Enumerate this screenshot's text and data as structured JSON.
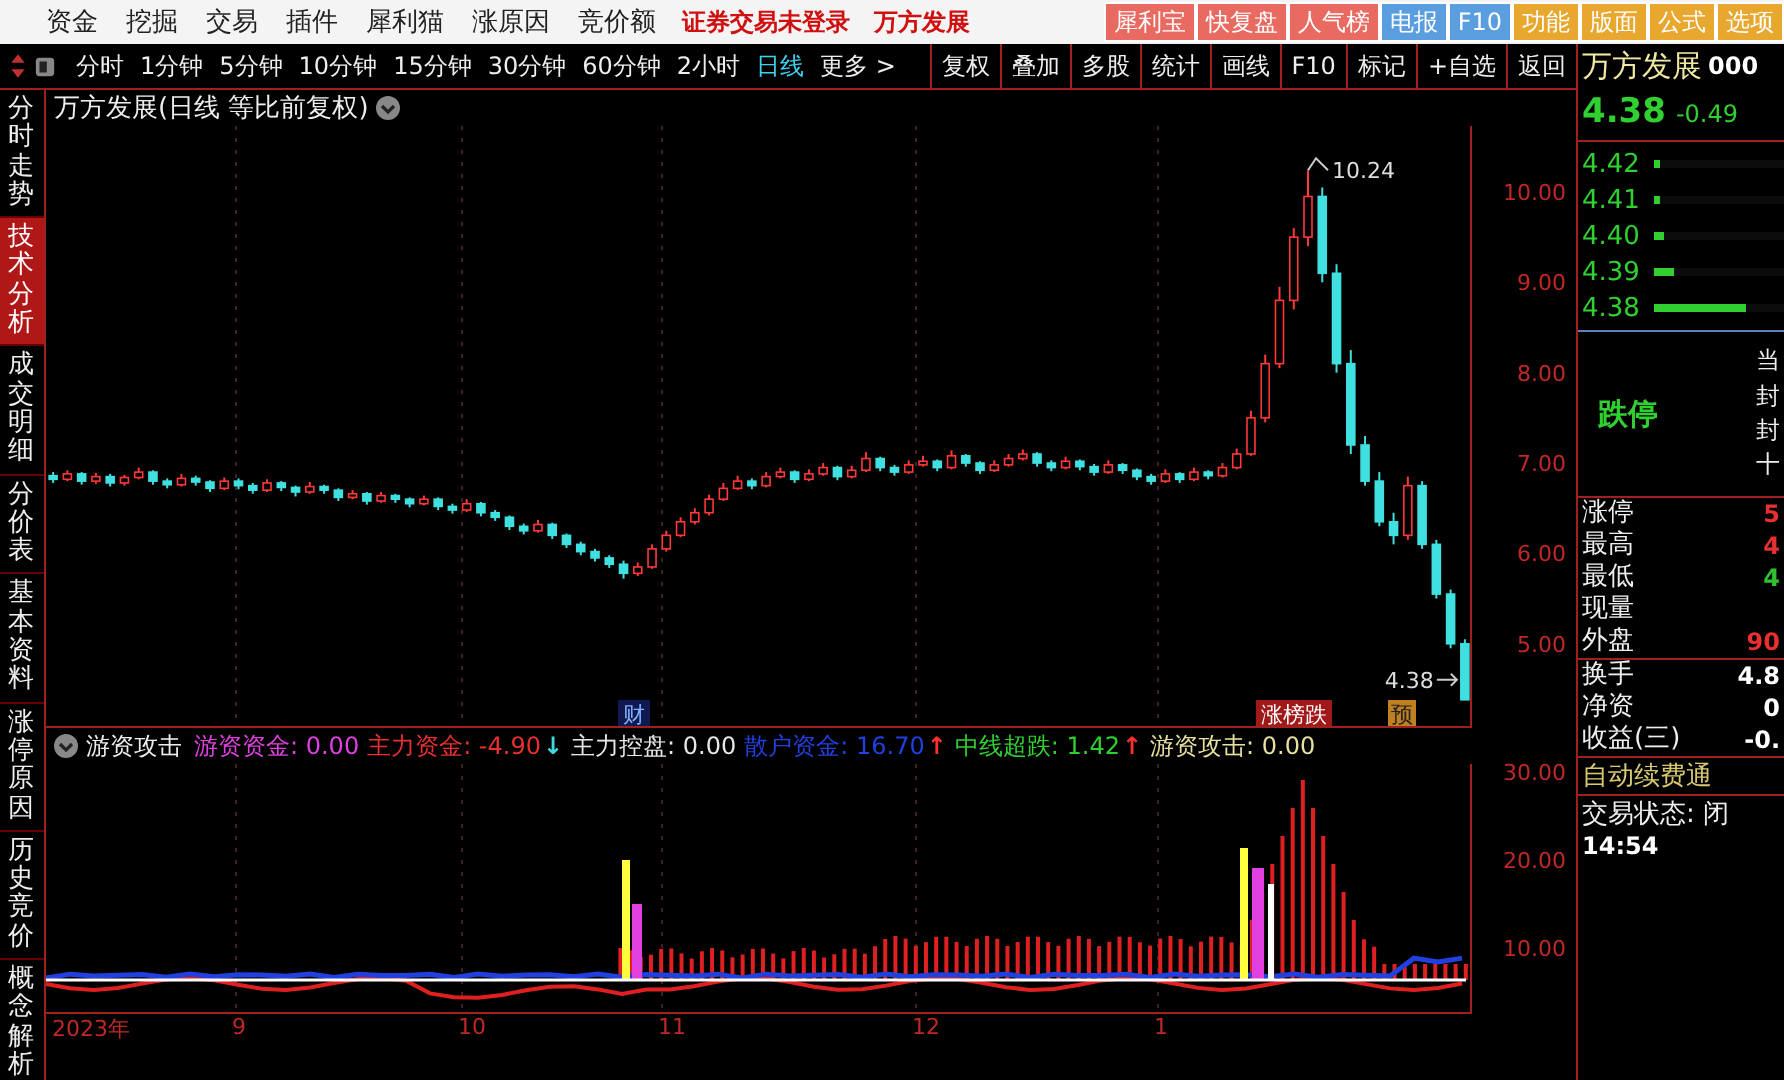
{
  "menu_bar": {
    "items": [
      "资金",
      "挖掘",
      "交易",
      "插件",
      "犀利猫",
      "涨原因",
      "竞价额"
    ],
    "status_texts": [
      "证券交易未登录",
      "万方发展"
    ],
    "buttons": [
      {
        "label": "犀利宝",
        "color": "#e86a60"
      },
      {
        "label": "快复盘",
        "color": "#e86a60"
      },
      {
        "label": "人气榜",
        "color": "#e86a60"
      },
      {
        "label": "电报",
        "color": "#5a9ee0"
      },
      {
        "label": "F10",
        "color": "#5a9ee0"
      },
      {
        "label": "功能",
        "color": "#e8a830"
      },
      {
        "label": "版面",
        "color": "#e8a830"
      },
      {
        "label": "公式",
        "color": "#e8a830"
      },
      {
        "label": "选项",
        "color": "#e8a830"
      }
    ]
  },
  "toolbar": {
    "periods": [
      {
        "label": "分时",
        "selected": false
      },
      {
        "label": "1分钟",
        "selected": false
      },
      {
        "label": "5分钟",
        "selected": false
      },
      {
        "label": "10分钟",
        "selected": false
      },
      {
        "label": "15分钟",
        "selected": false
      },
      {
        "label": "30分钟",
        "selected": false
      },
      {
        "label": "60分钟",
        "selected": false
      },
      {
        "label": "2小时",
        "selected": false
      },
      {
        "label": "日线",
        "selected": true
      },
      {
        "label": "更多 >",
        "selected": false
      }
    ],
    "tools": [
      "复权",
      "叠加",
      "多股",
      "统计",
      "画线",
      "F10",
      "标记",
      "+自选",
      "返回"
    ]
  },
  "side_tabs": [
    {
      "label": "分时走势",
      "selected": false
    },
    {
      "label": "技术分析",
      "selected": true
    },
    {
      "label": "成交明细",
      "selected": false
    },
    {
      "label": "分价表",
      "selected": false
    },
    {
      "label": "基本资料",
      "selected": false
    },
    {
      "label": "涨停原因",
      "selected": false
    },
    {
      "label": "历史竞价",
      "selected": false
    },
    {
      "label": "概念解析",
      "selected": false
    }
  ],
  "chart": {
    "title": "万方发展(日线 等比前复权)",
    "high_label": "10.24",
    "last_label": "4.38",
    "markers": [
      {
        "label": "财",
        "kind": "event"
      },
      {
        "label": "涨榜跌",
        "kind": "hot"
      },
      {
        "label": "预",
        "kind": "forecast"
      }
    ],
    "chart_data": {
      "type": "candlestick",
      "ylim": [
        4.09,
        10.73
      ],
      "yticks": [
        {
          "value": 10,
          "label": "10.00"
        },
        {
          "value": 9,
          "label": "9.00"
        },
        {
          "value": 8,
          "label": "8.00"
        },
        {
          "value": 7,
          "label": "7.00"
        },
        {
          "value": 6,
          "label": "6.00"
        },
        {
          "value": 5,
          "label": "5.00"
        }
      ],
      "ohlc": [
        [
          6.86,
          6.9,
          6.78,
          6.82
        ],
        [
          6.82,
          6.92,
          6.8,
          6.88
        ],
        [
          6.88,
          6.9,
          6.76,
          6.8
        ],
        [
          6.8,
          6.89,
          6.77,
          6.85
        ],
        [
          6.85,
          6.88,
          6.74,
          6.78
        ],
        [
          6.78,
          6.87,
          6.75,
          6.84
        ],
        [
          6.84,
          6.95,
          6.82,
          6.9
        ],
        [
          6.9,
          6.92,
          6.76,
          6.8
        ],
        [
          6.8,
          6.83,
          6.72,
          6.76
        ],
        [
          6.76,
          6.88,
          6.74,
          6.83
        ],
        [
          6.83,
          6.86,
          6.75,
          6.79
        ],
        [
          6.79,
          6.81,
          6.68,
          6.72
        ],
        [
          6.72,
          6.84,
          6.7,
          6.8
        ],
        [
          6.8,
          6.83,
          6.71,
          6.75
        ],
        [
          6.75,
          6.78,
          6.66,
          6.7
        ],
        [
          6.7,
          6.82,
          6.68,
          6.78
        ],
        [
          6.78,
          6.8,
          6.69,
          6.73
        ],
        [
          6.73,
          6.75,
          6.63,
          6.68
        ],
        [
          6.68,
          6.79,
          6.66,
          6.74
        ],
        [
          6.74,
          6.76,
          6.66,
          6.7
        ],
        [
          6.7,
          6.72,
          6.58,
          6.62
        ],
        [
          6.62,
          6.7,
          6.6,
          6.66
        ],
        [
          6.66,
          6.68,
          6.54,
          6.58
        ],
        [
          6.58,
          6.68,
          6.56,
          6.64
        ],
        [
          6.64,
          6.66,
          6.56,
          6.6
        ],
        [
          6.6,
          6.62,
          6.51,
          6.55
        ],
        [
          6.55,
          6.64,
          6.53,
          6.6
        ],
        [
          6.6,
          6.62,
          6.48,
          6.52
        ],
        [
          6.52,
          6.55,
          6.44,
          6.48
        ],
        [
          6.48,
          6.6,
          6.46,
          6.55
        ],
        [
          6.55,
          6.57,
          6.41,
          6.45
        ],
        [
          6.45,
          6.48,
          6.36,
          6.4
        ],
        [
          6.4,
          6.42,
          6.26,
          6.3
        ],
        [
          6.3,
          6.33,
          6.21,
          6.25
        ],
        [
          6.25,
          6.37,
          6.23,
          6.32
        ],
        [
          6.32,
          6.34,
          6.16,
          6.2
        ],
        [
          6.2,
          6.22,
          6.06,
          6.1
        ],
        [
          6.1,
          6.13,
          5.98,
          6.02
        ],
        [
          6.02,
          6.05,
          5.91,
          5.95
        ],
        [
          5.95,
          5.98,
          5.84,
          5.88
        ],
        [
          5.88,
          5.92,
          5.72,
          5.78
        ],
        [
          5.78,
          5.9,
          5.75,
          5.85
        ],
        [
          5.85,
          6.1,
          5.83,
          6.05
        ],
        [
          6.05,
          6.25,
          6.02,
          6.2
        ],
        [
          6.2,
          6.4,
          6.18,
          6.35
        ],
        [
          6.35,
          6.5,
          6.32,
          6.45
        ],
        [
          6.45,
          6.65,
          6.42,
          6.6
        ],
        [
          6.6,
          6.78,
          6.58,
          6.72
        ],
        [
          6.72,
          6.86,
          6.7,
          6.8
        ],
        [
          6.8,
          6.83,
          6.71,
          6.75
        ],
        [
          6.75,
          6.9,
          6.73,
          6.85
        ],
        [
          6.85,
          6.95,
          6.83,
          6.9
        ],
        [
          6.9,
          6.92,
          6.78,
          6.82
        ],
        [
          6.82,
          6.93,
          6.8,
          6.88
        ],
        [
          6.88,
          7.0,
          6.86,
          6.95
        ],
        [
          6.95,
          6.97,
          6.81,
          6.85
        ],
        [
          6.85,
          6.97,
          6.83,
          6.92
        ],
        [
          6.92,
          7.12,
          6.9,
          7.05
        ],
        [
          7.05,
          7.07,
          6.91,
          6.95
        ],
        [
          6.95,
          6.98,
          6.86,
          6.9
        ],
        [
          6.9,
          7.03,
          6.88,
          6.98
        ],
        [
          6.98,
          7.08,
          6.96,
          7.02
        ],
        [
          7.02,
          7.04,
          6.91,
          6.95
        ],
        [
          6.95,
          7.14,
          6.93,
          7.08
        ],
        [
          7.08,
          7.1,
          6.96,
          7.0
        ],
        [
          7.0,
          7.02,
          6.88,
          6.92
        ],
        [
          6.92,
          7.03,
          6.9,
          6.98
        ],
        [
          6.98,
          7.1,
          6.96,
          7.05
        ],
        [
          7.05,
          7.15,
          7.03,
          7.1
        ],
        [
          7.1,
          7.12,
          6.96,
          7.0
        ],
        [
          7.0,
          7.03,
          6.91,
          6.95
        ],
        [
          6.95,
          7.07,
          6.93,
          7.02
        ],
        [
          7.02,
          7.04,
          6.92,
          6.96
        ],
        [
          6.96,
          6.99,
          6.86,
          6.9
        ],
        [
          6.9,
          7.03,
          6.88,
          6.98
        ],
        [
          6.98,
          7.0,
          6.88,
          6.92
        ],
        [
          6.92,
          6.94,
          6.81,
          6.85
        ],
        [
          6.85,
          6.88,
          6.76,
          6.8
        ],
        [
          6.8,
          6.93,
          6.78,
          6.88
        ],
        [
          6.88,
          6.9,
          6.78,
          6.82
        ],
        [
          6.82,
          6.95,
          6.8,
          6.9
        ],
        [
          6.9,
          6.92,
          6.82,
          6.86
        ],
        [
          6.86,
          7.0,
          6.84,
          6.95
        ],
        [
          6.95,
          7.16,
          6.93,
          7.1
        ],
        [
          7.1,
          7.58,
          7.08,
          7.5
        ],
        [
          7.5,
          8.2,
          7.45,
          8.1
        ],
        [
          8.1,
          8.95,
          8.05,
          8.8
        ],
        [
          8.8,
          9.6,
          8.7,
          9.5
        ],
        [
          9.5,
          10.24,
          9.4,
          9.95
        ],
        [
          9.95,
          10.05,
          9.0,
          9.1
        ],
        [
          9.1,
          9.2,
          8.0,
          8.1
        ],
        [
          8.1,
          8.25,
          7.1,
          7.2
        ],
        [
          7.2,
          7.3,
          6.75,
          6.8
        ],
        [
          6.8,
          6.9,
          6.3,
          6.35
        ],
        [
          6.35,
          6.45,
          6.1,
          6.2
        ],
        [
          6.2,
          6.85,
          6.15,
          6.75
        ],
        [
          6.75,
          6.8,
          6.05,
          6.1
        ],
        [
          6.1,
          6.15,
          5.5,
          5.55
        ],
        [
          5.55,
          5.6,
          4.95,
          5.0
        ],
        [
          5.0,
          5.05,
          4.38,
          4.38
        ]
      ]
    }
  },
  "indicator": {
    "name": "游资攻击",
    "axis": [
      "30.00",
      "20.00",
      "10.00"
    ],
    "series": [
      {
        "label": "游资资金: 0.00",
        "color": "#e040e0"
      },
      {
        "label": "主力资金: -4.90",
        "color": "#e83030",
        "arrow": "↓",
        "kind": "down"
      },
      {
        "label": "主力控盘: 0.00",
        "color": "#e8e8e8"
      },
      {
        "label": "散户资金: 16.70",
        "color": "#2040e0",
        "arrow": "↑",
        "kind": "up"
      },
      {
        "label": "中线超跌: 1.42",
        "color": "#30d030",
        "arrow": "↑",
        "kind": "up"
      },
      {
        "label": "游资攻击: 0.00",
        "color": "#e8e0a0"
      }
    ]
  },
  "date_axis": [
    "2023年",
    "9",
    "10",
    "11",
    "12",
    "1"
  ],
  "quote_panel": {
    "name": "万方发展",
    "code": "000",
    "price": "4.38",
    "change": "-0.49",
    "book": [
      {
        "price": "4.42",
        "level": 0.04
      },
      {
        "price": "4.41",
        "level": 0.04
      },
      {
        "price": "4.40",
        "level": 0.08
      },
      {
        "price": "4.39",
        "level": 0.16
      },
      {
        "price": "4.38",
        "level": 0.7
      }
    ],
    "limit_state": "跌停",
    "side_chars": [
      "当",
      "封",
      "封",
      "十"
    ],
    "stats": [
      {
        "label": "涨停",
        "value": "5",
        "color": "#e83030"
      },
      {
        "label": "最高",
        "value": "4",
        "color": "#e83030"
      },
      {
        "label": "最低",
        "value": "4",
        "color": "#30c030"
      },
      {
        "label": "现量"
      },
      {
        "label": "外盘",
        "value": "90",
        "color": "#e83030"
      }
    ],
    "finance": [
      {
        "label": "换手",
        "value": "4.8"
      },
      {
        "label": "净资",
        "value": "0"
      },
      {
        "label": "收益(三)",
        "value": "-0."
      }
    ],
    "notice": "自动续费通",
    "trade_state": "交易状态: 闭",
    "time": "14:54"
  }
}
